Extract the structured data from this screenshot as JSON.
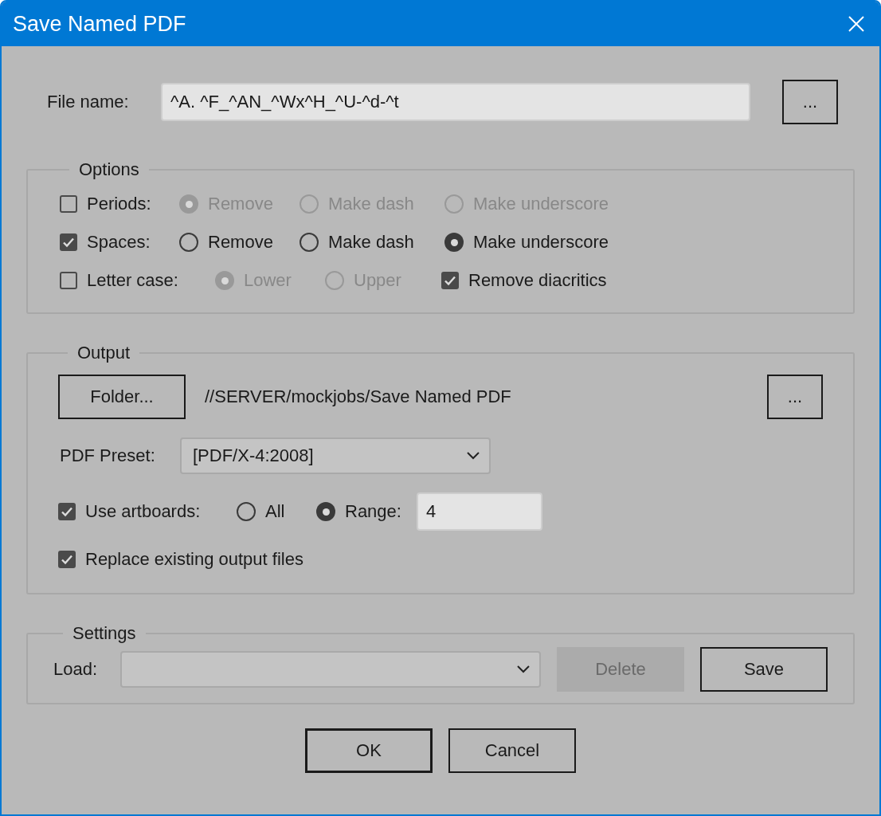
{
  "window": {
    "title": "Save Named PDF"
  },
  "file_name": {
    "label": "File name:",
    "value": "^A. ^F_^AN_^Wx^H_^U-^d-^t",
    "browse_button": "..."
  },
  "options": {
    "title": "Options",
    "rows": [
      {
        "label": "Periods:",
        "checked": false,
        "radios": [
          {
            "label": "Remove",
            "selected": true,
            "disabled": true
          },
          {
            "label": "Make dash",
            "selected": false,
            "disabled": true
          },
          {
            "label": "Make underscore",
            "selected": false,
            "disabled": true
          }
        ]
      },
      {
        "label": "Spaces:",
        "checked": true,
        "radios": [
          {
            "label": "Remove",
            "selected": false,
            "disabled": false
          },
          {
            "label": "Make dash",
            "selected": false,
            "disabled": false
          },
          {
            "label": "Make underscore",
            "selected": true,
            "disabled": false
          }
        ]
      },
      {
        "label": "Letter case:",
        "checked": false,
        "radios": [
          {
            "label": "Lower",
            "selected": true,
            "disabled": true
          },
          {
            "label": "Upper",
            "selected": false,
            "disabled": true
          }
        ],
        "extra": {
          "label": "Remove diacritics",
          "checked": true
        }
      }
    ]
  },
  "output": {
    "title": "Output",
    "folder_button": "Folder...",
    "folder_path": "//SERVER/mockjobs/Save Named PDF",
    "browse_button": "...",
    "preset": {
      "label": "PDF Preset:",
      "value": "[PDF/X-4:2008]"
    },
    "artboards": {
      "label": "Use artboards:",
      "checked": true,
      "radios": [
        {
          "label": "All",
          "selected": false
        },
        {
          "label": "Range:",
          "selected": true
        }
      ],
      "range": "4"
    },
    "replace": {
      "label": "Replace existing output files",
      "checked": true
    }
  },
  "settings": {
    "title": "Settings",
    "load_label": "Load:",
    "delete_button": {
      "label": "Delete",
      "disabled": true
    },
    "save_button": {
      "label": "Save",
      "disabled": false
    }
  },
  "buttons": [
    {
      "label": "OK",
      "default": true
    },
    {
      "label": "Cancel",
      "default": false
    }
  ]
}
